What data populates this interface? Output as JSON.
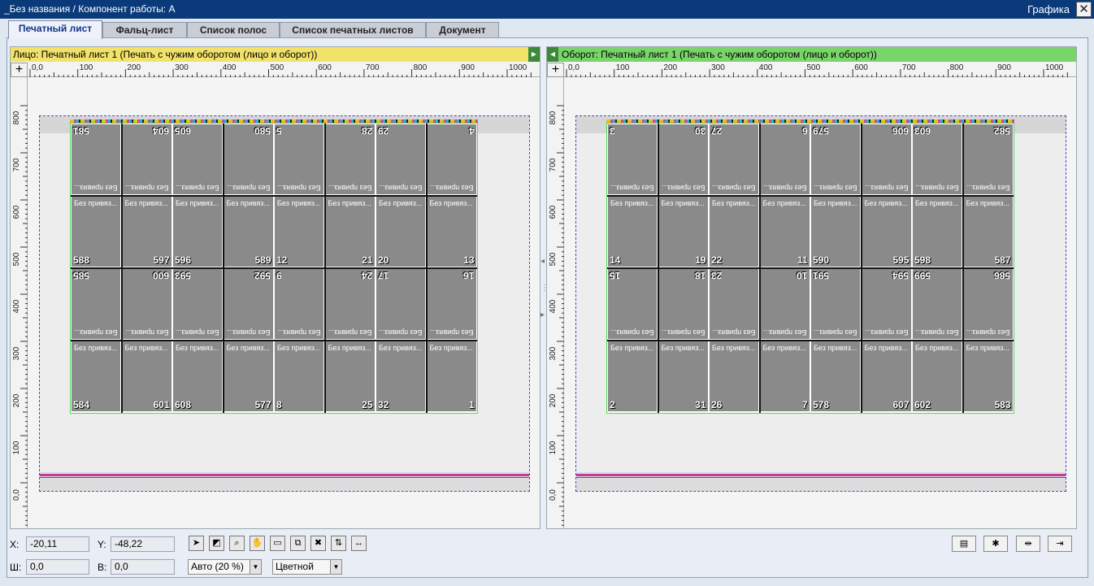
{
  "window": {
    "title": "_Без названия / Компонент работы: А",
    "right_label": "Графика",
    "close": "✕"
  },
  "tabs": [
    {
      "label": "Печатный лист"
    },
    {
      "label": "Фальц-лист"
    },
    {
      "label": "Список полос"
    },
    {
      "label": "Список печатных листов"
    },
    {
      "label": "Документ"
    }
  ],
  "left_pane": {
    "header": "Лицо:  Печатный лист 1 (Печать с чужим оборотом (лицо и оборот))",
    "ruler_marks": [
      "0,0",
      "100",
      "200",
      "300",
      "400",
      "500",
      "600",
      "700",
      "800",
      "900",
      "1000"
    ],
    "vruler_marks": [
      "800",
      "700",
      "600",
      "500",
      "400",
      "300",
      "200",
      "100",
      "0,0"
    ]
  },
  "right_pane": {
    "header": "Оборот:  Печатный лист 1 (Печать с чужим оборотом (лицо и оборот))",
    "ruler_marks": [
      "0,0",
      "100",
      "200",
      "300",
      "400",
      "500",
      "600",
      "700",
      "800",
      "900",
      "1000"
    ],
    "vruler_marks": [
      "800",
      "700",
      "600",
      "500",
      "400",
      "300",
      "200",
      "100",
      "0,0"
    ]
  },
  "cell_label": "Без привяз...",
  "left_rows": [
    {
      "dir": "dn",
      "nums": [
        [
          "581",
          ""
        ],
        [
          "",
          "604"
        ],
        [
          "605",
          ""
        ],
        [
          "",
          "580"
        ],
        [
          "5",
          ""
        ],
        [
          "",
          "28"
        ],
        [
          "29",
          ""
        ],
        [
          "",
          "4"
        ]
      ]
    },
    {
      "dir": "up",
      "nums": [
        [
          "588",
          ""
        ],
        [
          "",
          "597"
        ],
        [
          "596",
          ""
        ],
        [
          "",
          "589"
        ],
        [
          "12",
          ""
        ],
        [
          "",
          "21"
        ],
        [
          "20",
          ""
        ],
        [
          "",
          "13"
        ]
      ]
    },
    {
      "dir": "dn",
      "nums": [
        [
          "585",
          ""
        ],
        [
          "",
          "600"
        ],
        [
          "593",
          ""
        ],
        [
          "",
          "592"
        ],
        [
          "9",
          ""
        ],
        [
          "",
          "24"
        ],
        [
          "17",
          ""
        ],
        [
          "",
          "16"
        ]
      ]
    },
    {
      "dir": "up",
      "nums": [
        [
          "584",
          ""
        ],
        [
          "",
          "601"
        ],
        [
          "608",
          ""
        ],
        [
          "",
          "577"
        ],
        [
          "8",
          ""
        ],
        [
          "",
          "25"
        ],
        [
          "32",
          ""
        ],
        [
          "",
          "1"
        ]
      ]
    }
  ],
  "right_rows": [
    {
      "dir": "dn",
      "nums": [
        [
          "3",
          ""
        ],
        [
          "",
          "30"
        ],
        [
          "27",
          ""
        ],
        [
          "",
          "6"
        ],
        [
          "579",
          ""
        ],
        [
          "",
          "606"
        ],
        [
          "603",
          ""
        ],
        [
          "",
          "582"
        ]
      ]
    },
    {
      "dir": "up",
      "nums": [
        [
          "14",
          ""
        ],
        [
          "",
          "19"
        ],
        [
          "22",
          ""
        ],
        [
          "",
          "11"
        ],
        [
          "590",
          ""
        ],
        [
          "",
          "595"
        ],
        [
          "598",
          ""
        ],
        [
          "",
          "587"
        ]
      ]
    },
    {
      "dir": "dn",
      "nums": [
        [
          "15",
          ""
        ],
        [
          "",
          "18"
        ],
        [
          "23",
          ""
        ],
        [
          "",
          "10"
        ],
        [
          "591",
          ""
        ],
        [
          "",
          "594"
        ],
        [
          "599",
          ""
        ],
        [
          "",
          "586"
        ]
      ]
    },
    {
      "dir": "up",
      "nums": [
        [
          "2",
          ""
        ],
        [
          "",
          "31"
        ],
        [
          "26",
          ""
        ],
        [
          "",
          "7"
        ],
        [
          "578",
          ""
        ],
        [
          "",
          "607"
        ],
        [
          "602",
          ""
        ],
        [
          "",
          "583"
        ]
      ]
    }
  ],
  "bottom": {
    "x_label": "X:",
    "x_value": "-20,11",
    "y_label": "Y:",
    "y_value": "-48,22",
    "w_label": "Ш:",
    "w_value": "0,0",
    "h_label": "В:",
    "h_value": "0,0",
    "zoom": "Авто (20 %)",
    "color_mode": "Цветной"
  }
}
